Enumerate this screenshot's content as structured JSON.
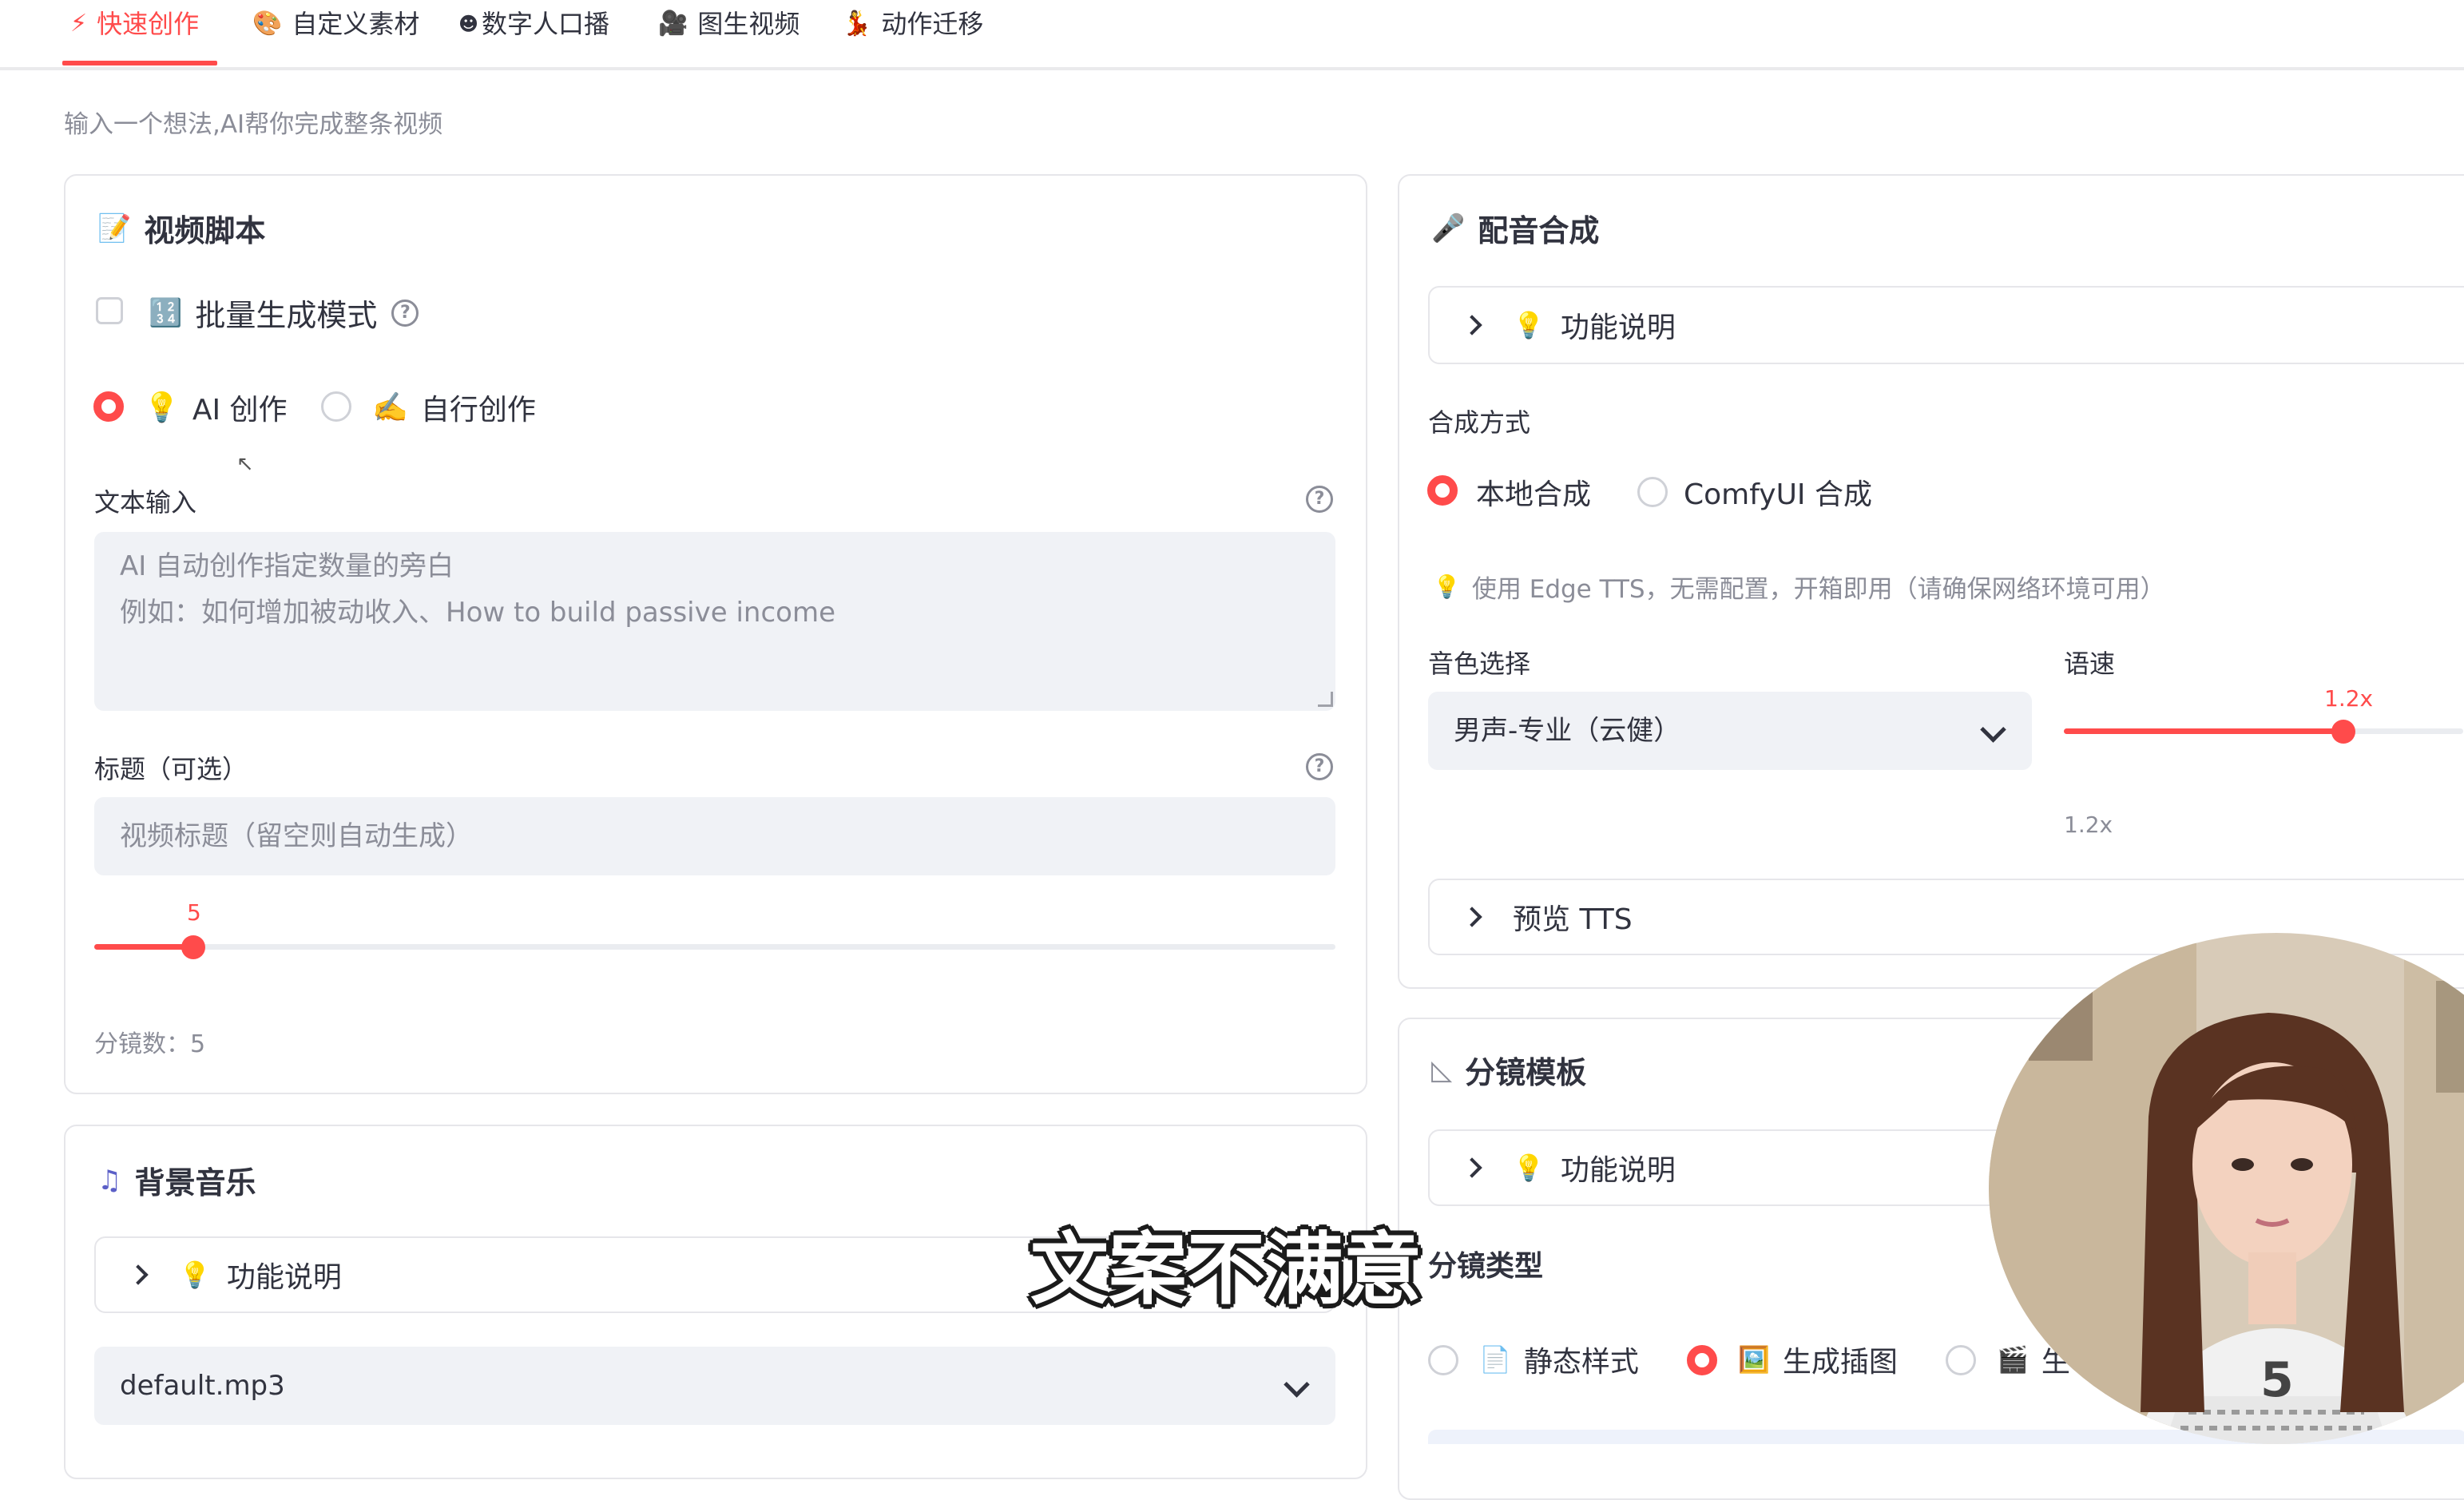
{
  "tabs": [
    {
      "icon": "⚡",
      "label": "快速创作",
      "active": true
    },
    {
      "icon": "🎨",
      "label": "自定义素材"
    },
    {
      "icon": "☻",
      "label": "数字人口播"
    },
    {
      "icon": "🎥",
      "label": "图生视频"
    },
    {
      "icon": "💃",
      "label": "动作迁移"
    }
  ],
  "subtitle": "输入一个想法,AI帮你完成整条视频",
  "script_card": {
    "title": "视频脚本",
    "batch_mode_label": "批量生成模式",
    "batch_icon": "🔢",
    "mode_options": [
      {
        "icon": "💡",
        "label": "AI 创作",
        "selected": true
      },
      {
        "icon": "✍️",
        "label": "自行创作",
        "selected": false
      }
    ],
    "text_input_label": "文本输入",
    "text_input_placeholder_line1": "AI 自动创作指定数量的旁白",
    "text_input_placeholder_line2": "例如：如何增加被动收入、How to build passive income",
    "title_label": "标题（可选）",
    "title_placeholder": "视频标题（留空则自动生成）",
    "scene_slider_value": "5",
    "scene_slider_fraction": 0.08,
    "scene_count_text": "分镜数：5"
  },
  "bgm_card": {
    "title": "背景音乐",
    "feature_desc_label": "功能说明",
    "music_select_value": "default.mp3"
  },
  "tts_card": {
    "title": "配音合成",
    "feature_desc_label": "功能说明",
    "synthesis_label": "合成方式",
    "synthesis_options": [
      {
        "label": "本地合成",
        "selected": true
      },
      {
        "label": "ComfyUI 合成",
        "selected": false
      }
    ],
    "info_text": "使用 Edge TTS，无需配置，开箱即用（请确保网络环境可用）",
    "voice_label": "音色选择",
    "voice_value": "男声-专业（云健）",
    "speed_label": "语速",
    "speed_value": "1.2x",
    "speed_readout": "1.2x",
    "speed_fraction": 0.7,
    "preview_label": "预览 TTS"
  },
  "storyboard_card": {
    "title": "分镜模板",
    "feature_desc_label": "功能说明",
    "type_label": "分镜类型",
    "type_options": [
      {
        "icon": "📄",
        "label": "静态样式",
        "selected": false
      },
      {
        "icon": "🖼️",
        "label": "生成插图",
        "selected": true
      },
      {
        "icon": "🎬",
        "label": "生",
        "selected": false
      }
    ]
  },
  "video_caption": "文案不满意",
  "colors": {
    "accent": "#ff4b4b",
    "border": "#e6e6ea",
    "input_bg": "#f0f2f6",
    "muted": "#8b8d98"
  }
}
